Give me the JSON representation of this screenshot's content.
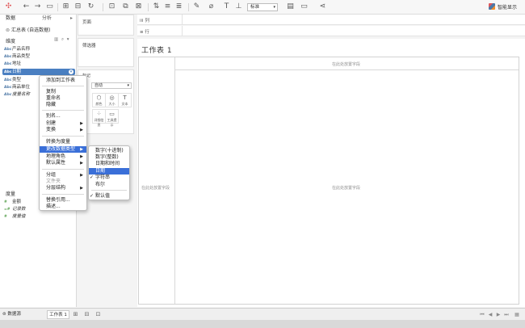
{
  "toolbar": {
    "fit_value": "标准",
    "show_me": "智能显示",
    "accent": "#3a6fd8"
  },
  "data_pane": {
    "tab_data": "数据",
    "tab_analysis": "分析",
    "datasource": "汇总表 (自选数据)",
    "dimensions_label": "维度",
    "dimensions": [
      {
        "type": "Abc",
        "name": "产品名称"
      },
      {
        "type": "Abc",
        "name": "商品类型"
      },
      {
        "type": "Abc",
        "name": "地址"
      },
      {
        "type": "Abc",
        "name": "日期"
      },
      {
        "type": "Abc",
        "name": "类型"
      },
      {
        "type": "Abc",
        "name": "商品单位"
      },
      {
        "type": "Abc",
        "name": "度量名称"
      }
    ],
    "measures_label": "度量",
    "measures": [
      {
        "type": "#",
        "name": "金额"
      },
      {
        "type": "=#",
        "name": "记录数"
      },
      {
        "type": "#",
        "name": "度量值"
      }
    ]
  },
  "shelves": {
    "pages": "页面",
    "filters": "筛选器",
    "marks": "标记",
    "mark_type": "自动",
    "mark_buttons": [
      "颜色",
      "大小",
      "文本",
      "详细信息",
      "工具提示"
    ],
    "columns": "列",
    "rows": "行"
  },
  "sheet": {
    "title": "工作表 1",
    "drop_top": "在此处放置字段",
    "drop_left": "在此处放置字段",
    "drop_center": "在此处放置字段"
  },
  "context_menu": {
    "items": [
      "添加到工作表",
      "复制",
      "重命名",
      "隐藏",
      "别名...",
      "创建",
      "变换",
      "转换为度量",
      "更改数据类型",
      "地理角色",
      "默认属性",
      "分组",
      "文件夹",
      "分层结构",
      "替换引用...",
      "描述..."
    ]
  },
  "submenu": {
    "items": [
      "数字(十进制)",
      "数字(整数)",
      "日期和时间",
      "日期",
      "字符串",
      "布尔",
      "默认值"
    ]
  },
  "bottom": {
    "datasource_tab": "数据源",
    "sheet_tab": "工作表 1"
  }
}
